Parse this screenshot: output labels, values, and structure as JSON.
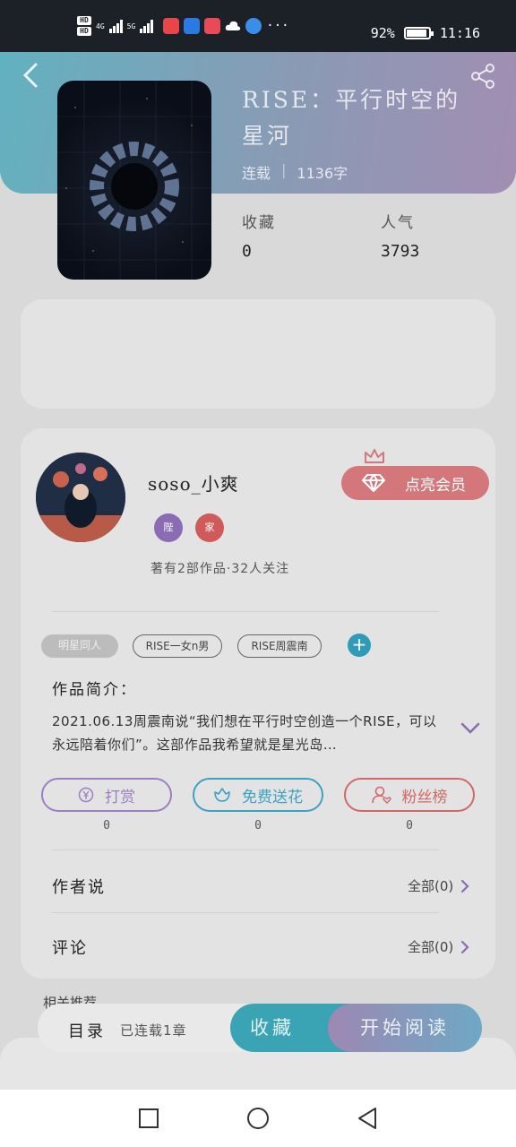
{
  "status_bar": {
    "network": "4G",
    "network2": "5G",
    "battery": "92%",
    "time": "11:16",
    "hd": "HD",
    "more": "···"
  },
  "book": {
    "title": "RISE：平行时空的星河",
    "status": "连载",
    "word_count": "1136字",
    "favorites_label": "收藏",
    "favorites_value": "0",
    "popularity_label": "人气",
    "popularity_value": "3793"
  },
  "author": {
    "name": "soso_小爽",
    "badge1": "陛",
    "badge2": "家",
    "works_info": "著有2部作品·32人关注",
    "vip_label": "点亮会员"
  },
  "tags": [
    "明星同人",
    "RISE一女n男",
    "RISE周震南"
  ],
  "intro": {
    "heading": "作品简介：",
    "text": "2021.06.13周震南说“我们想在平行时空创造一个RISE，可以永远陪着你们”。这部作品我希望就是星光岛…"
  },
  "actions": [
    {
      "label": "打赏",
      "count": "0",
      "icon": "yen-icon",
      "color": "#9b7fc4"
    },
    {
      "label": "免费送花",
      "count": "0",
      "icon": "flower-icon",
      "color": "#3aa3c4"
    },
    {
      "label": "粉丝榜",
      "count": "0",
      "icon": "fans-icon",
      "color": "#d06868"
    }
  ],
  "rows": {
    "author_says_label": "作者说",
    "author_says_link": "全部(0)",
    "comments_label": "评论",
    "comments_link": "全部(0)"
  },
  "bottom": {
    "peek_text": "相关推荐",
    "toc_label": "目录",
    "serial_info": "已连载1章",
    "favorite_button": "收藏",
    "read_button": "开始阅读"
  },
  "colors": {
    "header_start": "#3aa4b8",
    "header_end": "#8f74a6",
    "vip": "#d3777a",
    "teal": "#3aa3b4"
  }
}
